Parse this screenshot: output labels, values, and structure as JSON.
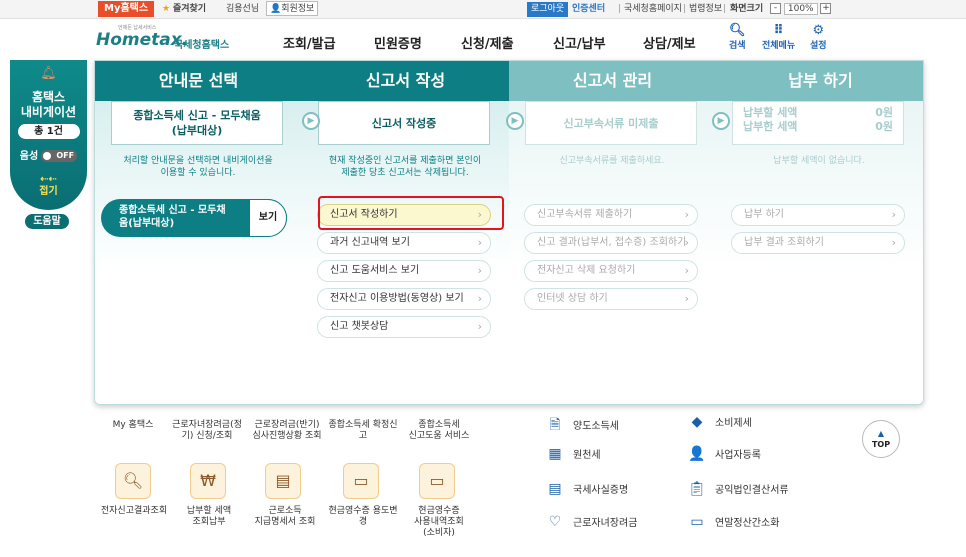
{
  "topbar": {
    "my_hometax": "My홈택스",
    "favorites": "즐겨찾기",
    "user": "김용선님",
    "member_info": "회원정보",
    "logout": "로그아웃",
    "cert_center": "인증센터",
    "nts_home": "국세청홈페이지",
    "law_info": "법령정보",
    "zoom_label": "화면크기",
    "zoom_minus": "-",
    "zoom_value": "100%",
    "zoom_plus": "+"
  },
  "header": {
    "logo_small": "언제든 납세서비스",
    "logo_main": "Hometax.",
    "logo_sub": "국세청홈택스",
    "nav": [
      "조회/발급",
      "민원증명",
      "신청/제출",
      "신고/납부",
      "상담/제보"
    ],
    "utils": [
      {
        "icon": "search-icon",
        "label": "검색"
      },
      {
        "icon": "menu-grid-icon",
        "label": "전체메뉴"
      },
      {
        "icon": "gear-icon",
        "label": "설정"
      }
    ]
  },
  "sidenav": {
    "title_line1": "홈택스",
    "title_line2": "내비게이션",
    "count": "총 1건",
    "voice_label": "음성",
    "toggle_label": "OFF",
    "collapse_arrows": "⇠⇠",
    "collapse_label": "접기",
    "help": "도움말"
  },
  "panel": {
    "col1": {
      "title": "안내문 선택",
      "box_line1": "종합소득세 신고 - 모두채움",
      "box_line2": "(납부대상)",
      "desc_line1": "처리할 안내문을 선택하면 내비게이션을",
      "desc_line2": "이용할 수 있습니다.",
      "guide_line1": "종합소득세 신고 - 모두채",
      "guide_line2": "움(납부대상)",
      "guide_view": "보기"
    },
    "col2": {
      "title": "신고서 작성",
      "box": "신고서 작성중",
      "desc_line1": "현재 작성중인 신고서를 제출하면 본인이",
      "desc_line2": "제출한 당초 신고서는 삭제됩니다.",
      "items": [
        "신고서 작성하기",
        "과거 신고내역 보기",
        "신고 도움서비스 보기",
        "전자신고 이용방법(동영상) 보기",
        "신고 챗봇상담"
      ]
    },
    "col3": {
      "title": "신고서 관리",
      "box": "신고부속서류 미제출",
      "desc": "신고부속서류를 제출하세요.",
      "items": [
        "신고부속서류 제출하기",
        "신고 결과(납부서, 접수증) 조회하기",
        "전자신고 삭제 요청하기",
        "인터넷 상담 하기"
      ]
    },
    "col4": {
      "title": "납부 하기",
      "pay_label1": "납부할 세액",
      "pay_value1": "0원",
      "pay_label2": "납부한 세액",
      "pay_value2": "0원",
      "desc": "납부할 세액이 없습니다.",
      "items": [
        "납부 하기",
        "납부 결과 조회하기"
      ]
    }
  },
  "background": {
    "row1": [
      {
        "line1": "My 홈택스",
        "line2": ""
      },
      {
        "line1": "근로자녀장려금(정",
        "line2": "기) 신청/조회"
      },
      {
        "line1": "근로장려금(반기)",
        "line2": "심사진행상황 조회"
      },
      {
        "line1": "종합소득세 확정신",
        "line2": "고"
      },
      {
        "line1": "종합소득세",
        "line2": "신고도움 서비스"
      }
    ],
    "row2": [
      {
        "line1": "전자신고결과조회",
        "line2": "",
        "line3": ""
      },
      {
        "line1": "납부할 세액",
        "line2": "조회납부",
        "line3": ""
      },
      {
        "line1": "근로소득",
        "line2": "지급명세서 조회",
        "line3": ""
      },
      {
        "line1": "현금영수증 용도변",
        "line2": "경",
        "line3": ""
      },
      {
        "line1": "현금영수증",
        "line2": "사용내역조회",
        "line3": "(소비자)"
      }
    ],
    "right_col1": [
      "양도소득세",
      "원천세",
      "국세사실증명",
      "근로자녀장려금"
    ],
    "right_col2": [
      "소비제세",
      "사업자등록",
      "공익법인결산서류",
      "연말정산간소화"
    ],
    "top_button": "TOP"
  }
}
